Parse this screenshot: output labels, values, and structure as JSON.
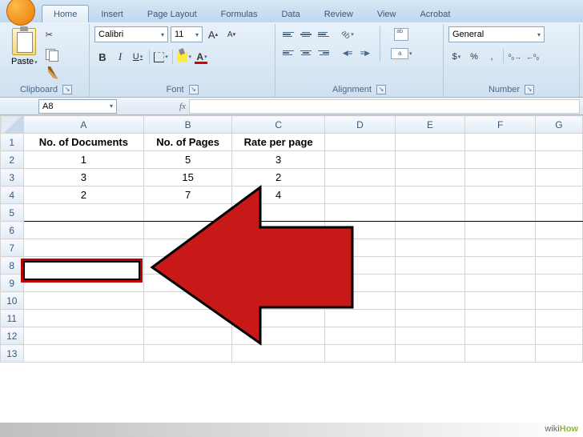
{
  "tabs": [
    "Home",
    "Insert",
    "Page Layout",
    "Formulas",
    "Data",
    "Review",
    "View",
    "Acrobat"
  ],
  "activeTab": 0,
  "clipboard": {
    "paste": "Paste",
    "label": "Clipboard"
  },
  "font": {
    "name": "Calibri",
    "size": "11",
    "label": "Font",
    "bold": "B",
    "italic": "I",
    "underline": "U",
    "grow": "A",
    "shrink": "A"
  },
  "alignment": {
    "label": "Alignment"
  },
  "number": {
    "format": "General",
    "label": "Number",
    "currency": "$",
    "percent": "%",
    "comma": ",",
    "inc": ".0",
    "dec": ".00"
  },
  "namebox": "A8",
  "fx": "fx",
  "columns": [
    "A",
    "B",
    "C",
    "D",
    "E",
    "F",
    "G"
  ],
  "rows": [
    "1",
    "2",
    "3",
    "4",
    "5",
    "6",
    "7",
    "8",
    "9",
    "10",
    "11",
    "12",
    "13"
  ],
  "data": {
    "headers": [
      "No. of Documents",
      "No. of Pages",
      "Rate per page"
    ],
    "r2": [
      "1",
      "5",
      "3"
    ],
    "r3": [
      "3",
      "15",
      "2"
    ],
    "r4": [
      "2",
      "7",
      "4"
    ]
  },
  "watermark": {
    "wiki": "wiki",
    "how": "How"
  }
}
